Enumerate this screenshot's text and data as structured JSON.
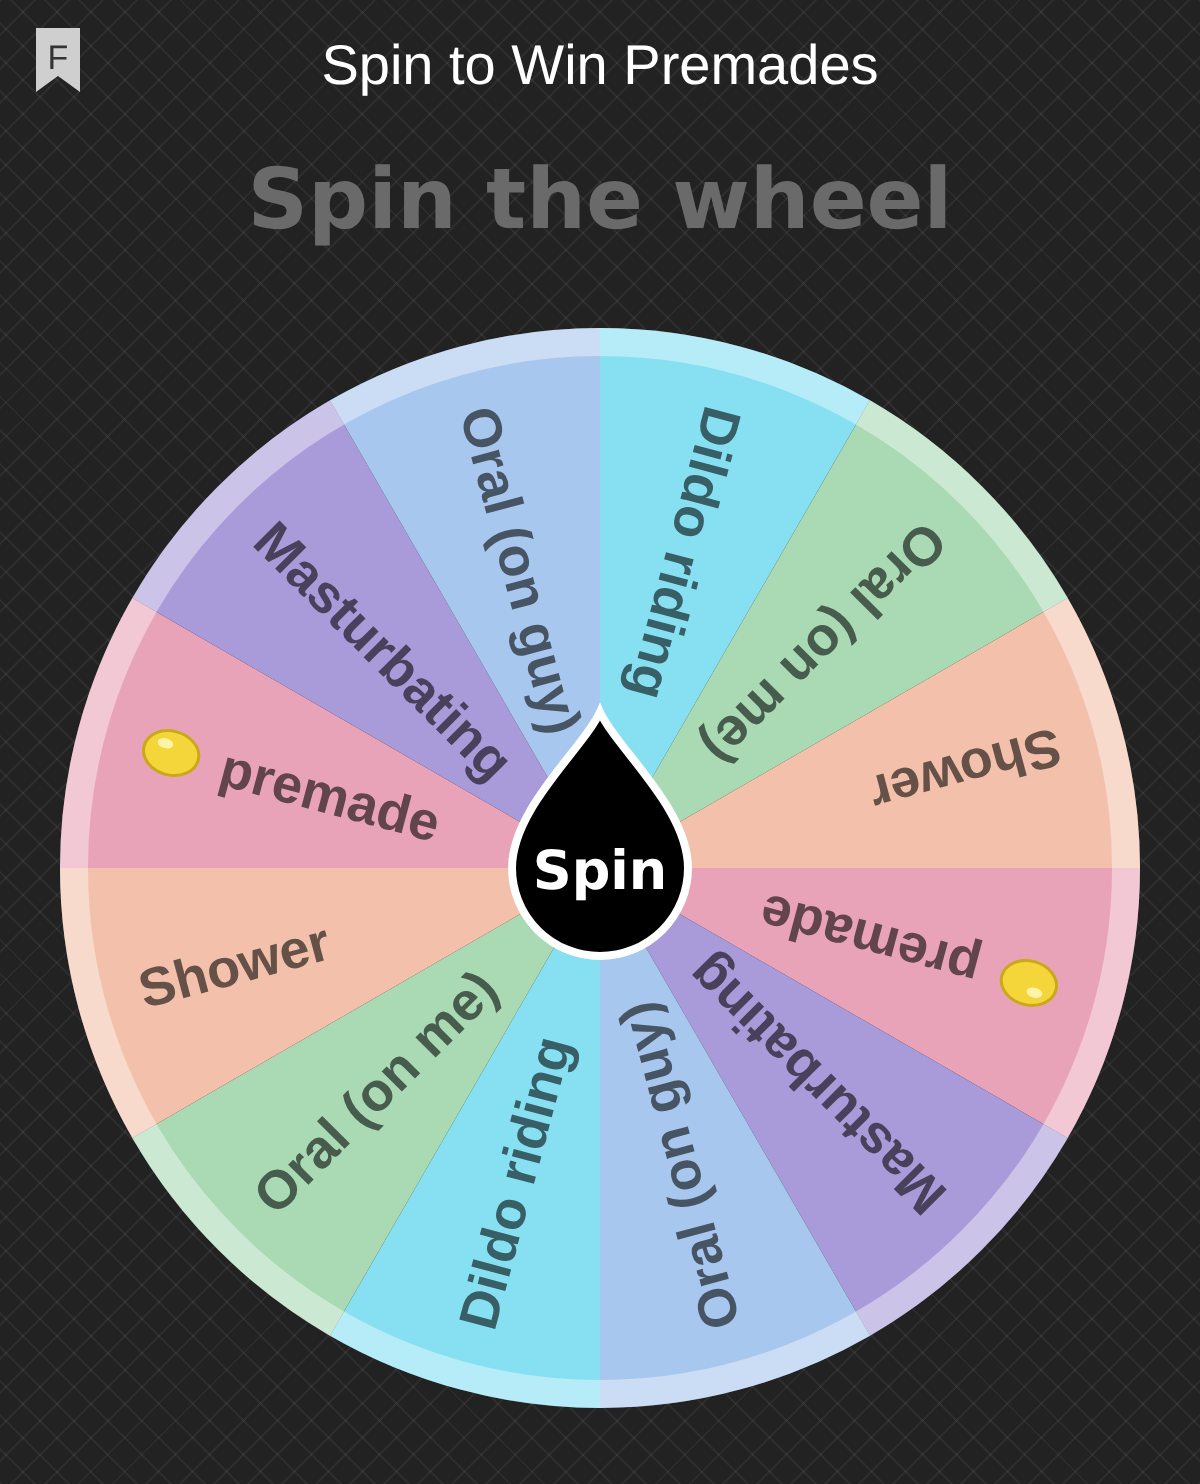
{
  "header": {
    "app_badge": "F",
    "title": "Spin to Win Premades"
  },
  "heading": "Spin the wheel",
  "wheel": {
    "segments": [
      {
        "label": "Dildo riding",
        "color": "#86e0f2",
        "lemon": false
      },
      {
        "label": "Oral (on me)",
        "color": "#a9dab4",
        "lemon": false
      },
      {
        "label": "Shower",
        "color": "#f3c1ab",
        "lemon": false
      },
      {
        "label": "premade",
        "color": "#e9a3b8",
        "lemon": true
      },
      {
        "label": "Masturbating",
        "color": "#a99bd9",
        "lemon": false
      },
      {
        "label": "Oral (on guy)",
        "color": "#a8c7ee",
        "lemon": false
      },
      {
        "label": "Dildo riding",
        "color": "#86e0f2",
        "lemon": false
      },
      {
        "label": "Oral (on me)",
        "color": "#a9dab4",
        "lemon": false
      },
      {
        "label": "Shower",
        "color": "#f3c1ab",
        "lemon": false
      },
      {
        "label": "premade",
        "color": "#e9a3b8",
        "lemon": true
      },
      {
        "label": "Masturbating",
        "color": "#a99bd9",
        "lemon": false
      },
      {
        "label": "Oral (on guy)",
        "color": "#a8c7ee",
        "lemon": false
      }
    ],
    "button": "Spin"
  }
}
